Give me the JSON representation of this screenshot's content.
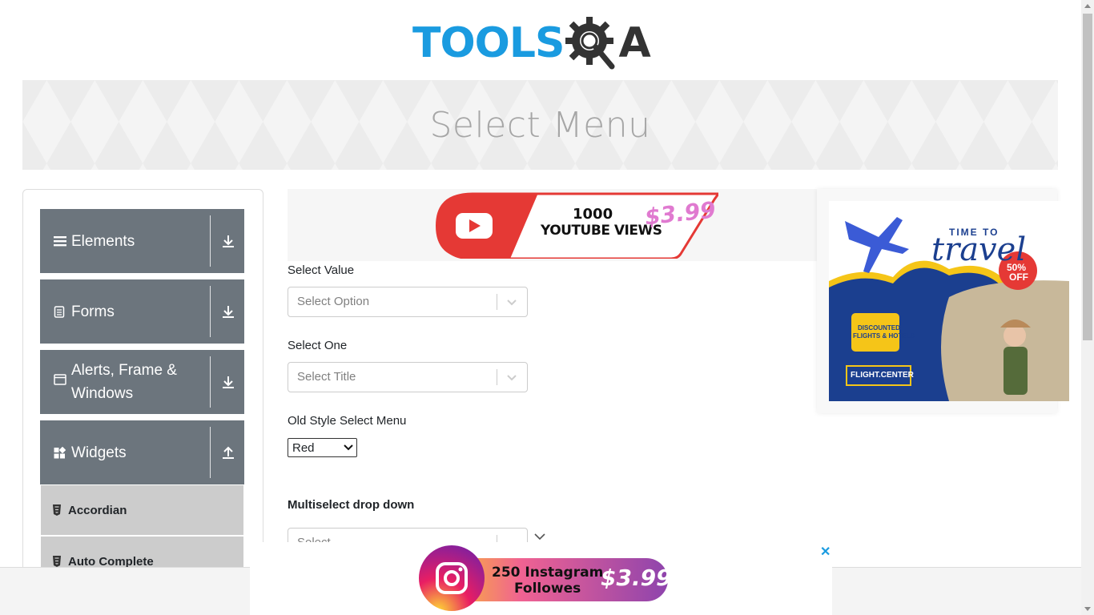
{
  "header": {
    "logo_text_left": "TOOLS",
    "logo_text_right": "A"
  },
  "banner": {
    "title": "Select Menu"
  },
  "sidebar": {
    "groups": [
      {
        "label": "Elements",
        "icon": "hamburger-icon",
        "arrow": "download-arrow-icon"
      },
      {
        "label": "Forms",
        "icon": "document-icon",
        "arrow": "download-arrow-icon"
      },
      {
        "label": "Alerts, Frame & Windows",
        "icon": "window-icon",
        "arrow": "download-arrow-icon"
      },
      {
        "label": "Widgets",
        "icon": "widgets-icon",
        "arrow": "upload-arrow-icon"
      }
    ],
    "items": [
      {
        "label": "Accordian",
        "icon": "html5-icon"
      },
      {
        "label": "Auto Complete",
        "icon": "html5-icon"
      }
    ]
  },
  "ads": {
    "top": {
      "line1": "1000",
      "line2": "YOUTUBE VIEWS",
      "price": "$3.99"
    },
    "right": {
      "headline_small": "TIME TO",
      "headline_big": "travel",
      "badge_pct": "50%",
      "badge_off": "OFF",
      "promo1": "DISCOUNTED",
      "promo2": "FLIGHTS & HOTELS",
      "brand": "FLIGHT.CENTER",
      "close": "✕"
    },
    "bottom": {
      "line1": "250 Instagram",
      "line2": "Followes",
      "price": "$3.99",
      "close": "✕"
    }
  },
  "form": {
    "select_value": {
      "label": "Select Value",
      "placeholder": "Select Option"
    },
    "select_one": {
      "label": "Select One",
      "placeholder": "Select Title"
    },
    "old_style": {
      "label": "Old Style Select Menu",
      "value": "Red"
    },
    "multiselect": {
      "label": "Multiselect drop down",
      "placeholder": "Select..."
    }
  },
  "colors": {
    "sidebar_group": "#6c757d",
    "sidebar_item": "#cccccc",
    "logo_blue": "#1a9be0"
  }
}
